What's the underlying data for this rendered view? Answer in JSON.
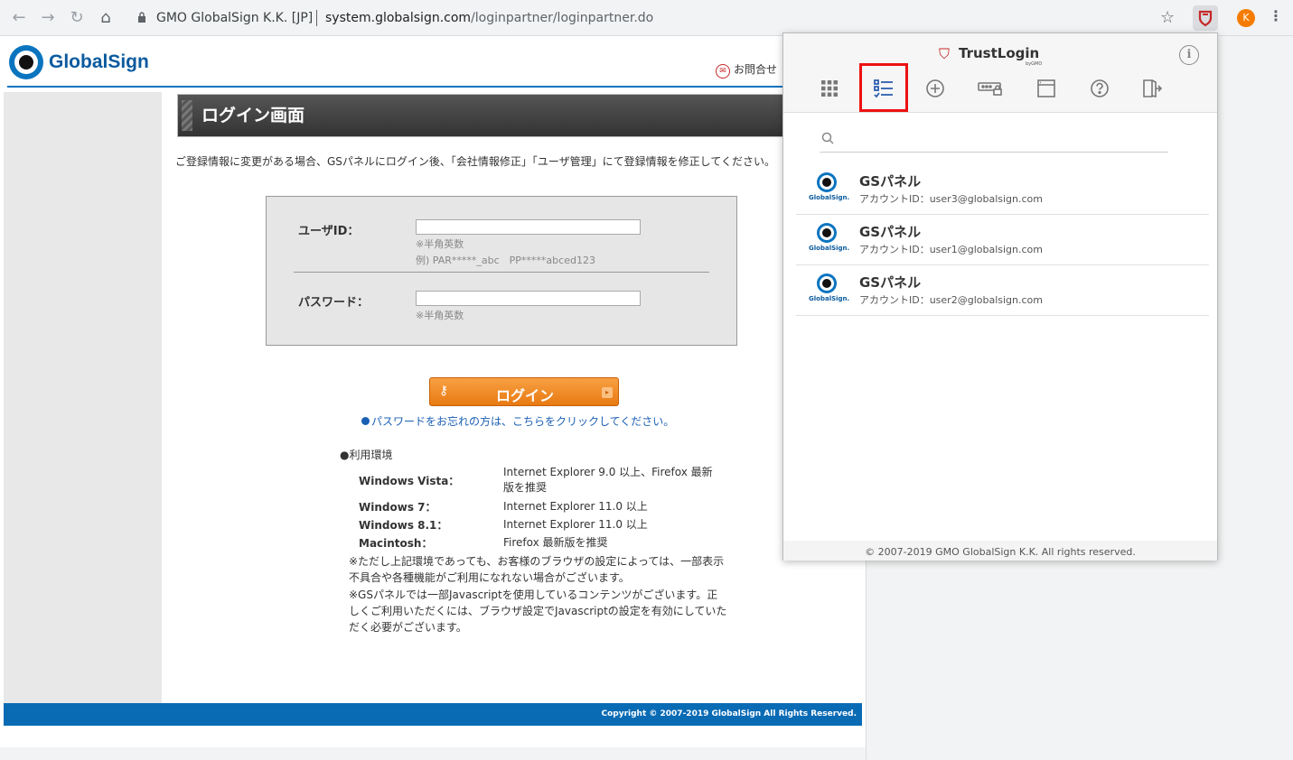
{
  "browser": {
    "site_name": "GMO GlobalSign K.K. [JP]",
    "url_host": "system.globalsign.com",
    "url_path": "/loginpartner/loginpartner.do",
    "avatar_letter": "K"
  },
  "page": {
    "logo_text": "GlobalSign",
    "contact_label": "お問合せ",
    "header_title": "ログイン画面",
    "intro": "ご登録情報に変更がある場合、GSパネルにログイン後、「会社情報修正」「ユーザ管理」にて登録情報を修正してください。",
    "form": {
      "userid_label": "ユーザID：",
      "userid_hint1": "※半角英数",
      "userid_hint2": "例) PAR*****_abc　PP*****abced123",
      "password_label": "パスワード：",
      "password_hint": "※半角英数"
    },
    "login_button": "ログイン",
    "forgot_link": "パスワードをお忘れの方は、こちらをクリックしてください。",
    "env_title": "●利用環境",
    "env": [
      {
        "os": "Windows Vista：",
        "browser": "Internet Explorer 9.0 以上、Firefox 最新版を推奨"
      },
      {
        "os": "Windows 7：",
        "browser": "Internet Explorer 11.0 以上"
      },
      {
        "os": "Windows 8.1：",
        "browser": "Internet Explorer 11.0 以上"
      },
      {
        "os": "Macintosh：",
        "browser": "Firefox 最新版を推奨"
      }
    ],
    "notes": [
      "※ただし上記環境であっても、お客様のブラウザの設定によっては、一部表示不具合や各種機能がご利用になれない場合がございます。",
      "※GSパネルでは一部Javascriptを使用しているコンテンツがございます。正しくご利用いただくには、ブラウザ設定でJavascriptの設定を有効にしていただく必要がございます。"
    ],
    "footer": "Copyright © 2007-2019 GlobalSign All Rights Reserved."
  },
  "popup": {
    "brand": "TrustLogin",
    "brand_sub": "byGMO",
    "tabs": [
      "apps-grid-icon",
      "checklist-icon",
      "add-circle-icon",
      "password-field-icon",
      "window-icon",
      "help-icon",
      "logout-icon"
    ],
    "search_placeholder": "",
    "accounts": [
      {
        "logo_text": "GlobalSign.",
        "name": "GSパネル",
        "account": "アカウントID：user3@globalsign.com"
      },
      {
        "logo_text": "GlobalSign.",
        "name": "GSパネル",
        "account": "アカウントID：user1@globalsign.com"
      },
      {
        "logo_text": "GlobalSign.",
        "name": "GSパネル",
        "account": "アカウントID：user2@globalsign.com"
      }
    ],
    "footer": "© 2007-2019 GMO GlobalSign K.K. All rights reserved."
  }
}
